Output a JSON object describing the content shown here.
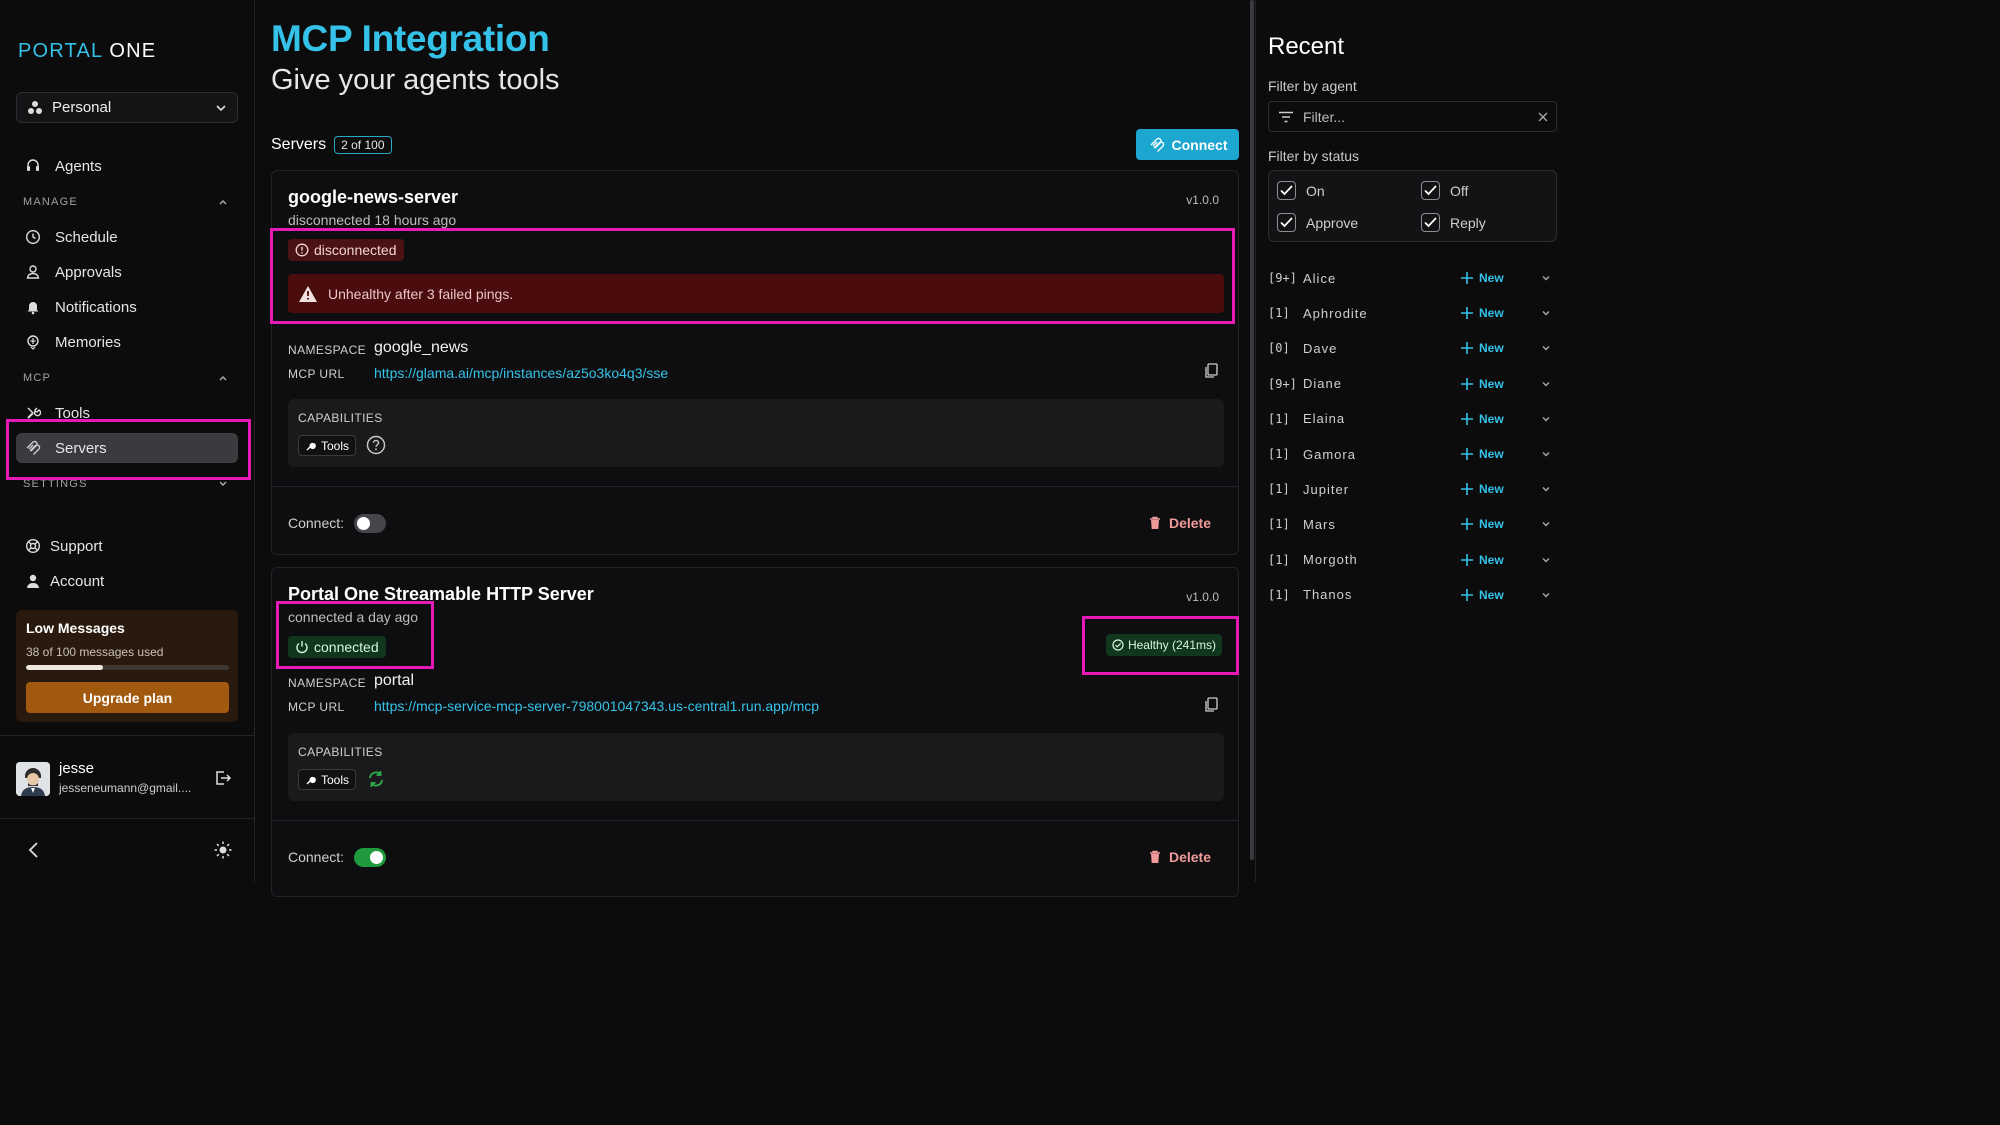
{
  "brand": {
    "part1": "PORTAL",
    "part2": "ONE"
  },
  "workspace": {
    "label": "Personal"
  },
  "nav": {
    "agents": "Agents",
    "manage_header": "MANAGE",
    "schedule": "Schedule",
    "approvals": "Approvals",
    "notifications": "Notifications",
    "memories": "Memories",
    "mcp_header": "MCP",
    "tools": "Tools",
    "servers": "Servers",
    "settings_header": "SETTINGS",
    "support": "Support",
    "account": "Account"
  },
  "low_messages": {
    "title": "Low Messages",
    "usage": "38 of 100 messages used",
    "progress": 0.38,
    "button": "Upgrade plan"
  },
  "user": {
    "name": "jesse",
    "email": "jesseneumann@gmail...."
  },
  "page": {
    "title": "MCP Integration",
    "subtitle": "Give your agents tools",
    "servers_label": "Servers",
    "servers_count": "2 of 100",
    "connect_button": "Connect"
  },
  "servers": [
    {
      "name": "google-news-server",
      "version": "v1.0.0",
      "last_seen": "disconnected 18 hours ago",
      "status": "disconnected",
      "alert": "Unhealthy after 3 failed pings.",
      "namespace_label": "NAMESPACE",
      "namespace": "google_news",
      "url_label": "MCP URL",
      "url": "https://glama.ai/mcp/instances/az5o3ko4q3/sse",
      "capabilities_label": "CAPABILITIES",
      "capability": "Tools",
      "connect_label": "Connect:",
      "connect_on": false,
      "delete_label": "Delete"
    },
    {
      "name": "Portal One Streamable HTTP Server",
      "version": "v1.0.0",
      "last_seen": "connected a day ago",
      "status": "connected",
      "health": "Healthy (241ms)",
      "namespace_label": "NAMESPACE",
      "namespace": "portal",
      "url_label": "MCP URL",
      "url": "https://mcp-service-mcp-server-798001047343.us-central1.run.app/mcp",
      "capabilities_label": "CAPABILITIES",
      "capability": "Tools",
      "connect_label": "Connect:",
      "connect_on": true,
      "delete_label": "Delete"
    }
  ],
  "recent": {
    "title": "Recent",
    "filter_agent_label": "Filter by agent",
    "filter_placeholder": "Filter...",
    "filter_status_label": "Filter by status",
    "statuses": [
      {
        "label": "On",
        "checked": true
      },
      {
        "label": "Off",
        "checked": true
      },
      {
        "label": "Approve",
        "checked": true
      },
      {
        "label": "Reply",
        "checked": true
      }
    ],
    "new_label": "New",
    "agents": [
      {
        "count": "[9+]",
        "name": "Alice"
      },
      {
        "count": "[1]",
        "name": "Aphrodite"
      },
      {
        "count": "[0]",
        "name": "Dave"
      },
      {
        "count": "[9+]",
        "name": "Diane"
      },
      {
        "count": "[1]",
        "name": "Elaina"
      },
      {
        "count": "[1]",
        "name": "Gamora"
      },
      {
        "count": "[1]",
        "name": "Jupiter"
      },
      {
        "count": "[1]",
        "name": "Mars"
      },
      {
        "count": "[1]",
        "name": "Morgoth"
      },
      {
        "count": "[1]",
        "name": "Thanos"
      }
    ]
  },
  "colors": {
    "accent": "#35c2e8",
    "highlight": "#e619b9",
    "danger": "#4a0c0c",
    "success": "#1f9a3c"
  }
}
